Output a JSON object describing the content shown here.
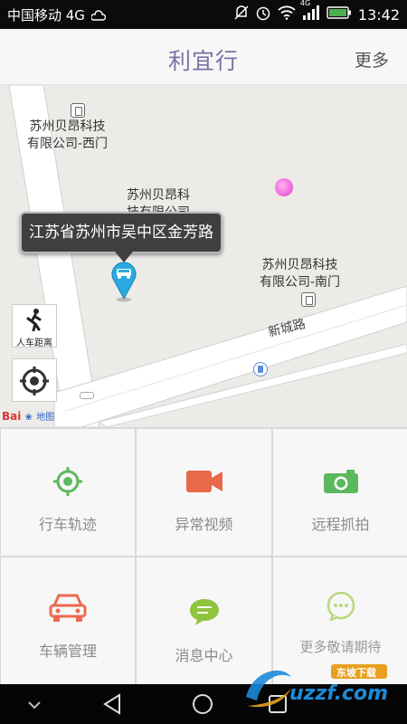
{
  "status_bar": {
    "carrier": "中国移动 4G",
    "network": "4G",
    "time": "13:42"
  },
  "header": {
    "title": "利宜行",
    "more_label": "更多"
  },
  "map": {
    "pois": [
      {
        "line1": "苏州贝昂科技",
        "line2": "有限公司-西门"
      },
      {
        "line1": "苏州贝昂科",
        "line2": "技有限公司"
      },
      {
        "line1": "苏州贝昂科技",
        "line2": "有限公司-南门"
      }
    ],
    "road_label": "新城路",
    "address_bubble": "江苏省苏州市吴中区金芳路",
    "distance_button_label": "人车距离",
    "logo_text": "Bai",
    "logo_suffix": "地图"
  },
  "features": [
    {
      "label": "行车轨迹",
      "icon": "target-icon",
      "color": "#5cb85c"
    },
    {
      "label": "异常视频",
      "icon": "video-camera-icon",
      "color": "#e8684a"
    },
    {
      "label": "远程抓拍",
      "icon": "camera-icon",
      "color": "#5cb85c"
    },
    {
      "label": "车辆管理",
      "icon": "car-icon",
      "color": "#ec6a4f"
    },
    {
      "label": "消息中心",
      "icon": "chat-bubble-icon",
      "color": "#8fc43f"
    },
    {
      "label": "更多敬请期待",
      "icon": "ellipsis-bubble-icon",
      "color": "#b9d87e"
    }
  ],
  "watermark": {
    "site": "uzzf.com",
    "tagline": "东坡下载"
  }
}
